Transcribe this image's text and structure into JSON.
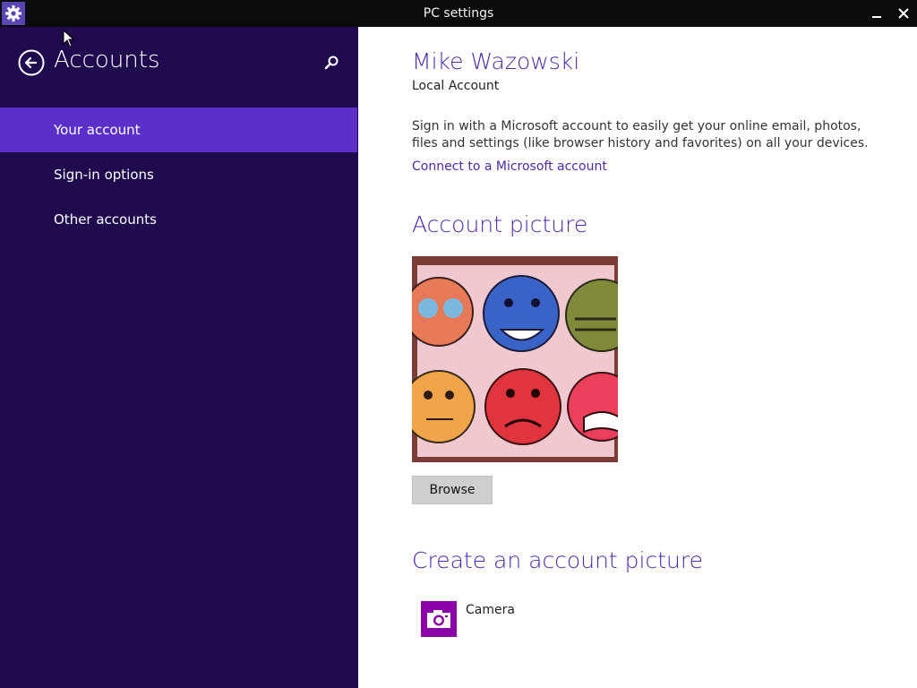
{
  "window": {
    "title": "PC settings",
    "icons": {
      "app": "gear-icon",
      "minimize": "minimize-icon",
      "close": "close-icon"
    }
  },
  "sidebar": {
    "title": "Accounts",
    "icons": {
      "back": "back-arrow-circle-icon",
      "search": "search-icon"
    },
    "items": [
      {
        "label": "Your account",
        "active": true
      },
      {
        "label": "Sign-in options",
        "active": false
      },
      {
        "label": "Other accounts",
        "active": false
      }
    ]
  },
  "main": {
    "user_name": "Mike Wazowski",
    "account_type": "Local Account",
    "description": "Sign in with a Microsoft account to easily get your online email, photos, files and settings (like browser history and favorites) on all your devices.",
    "connect_link": "Connect to a Microsoft account",
    "account_picture_heading": "Account picture",
    "browse_label": "Browse",
    "create_heading": "Create an account picture",
    "camera_label": "Camera",
    "camera_icon": "camera-icon"
  },
  "colors": {
    "sidebar_bg": "#1f0a4d",
    "sidebar_active": "#5b2fc9",
    "accent": "#4b2aa8",
    "titlebar_bg": "#0b0b0b",
    "camera_tile": "#8b00a8"
  }
}
